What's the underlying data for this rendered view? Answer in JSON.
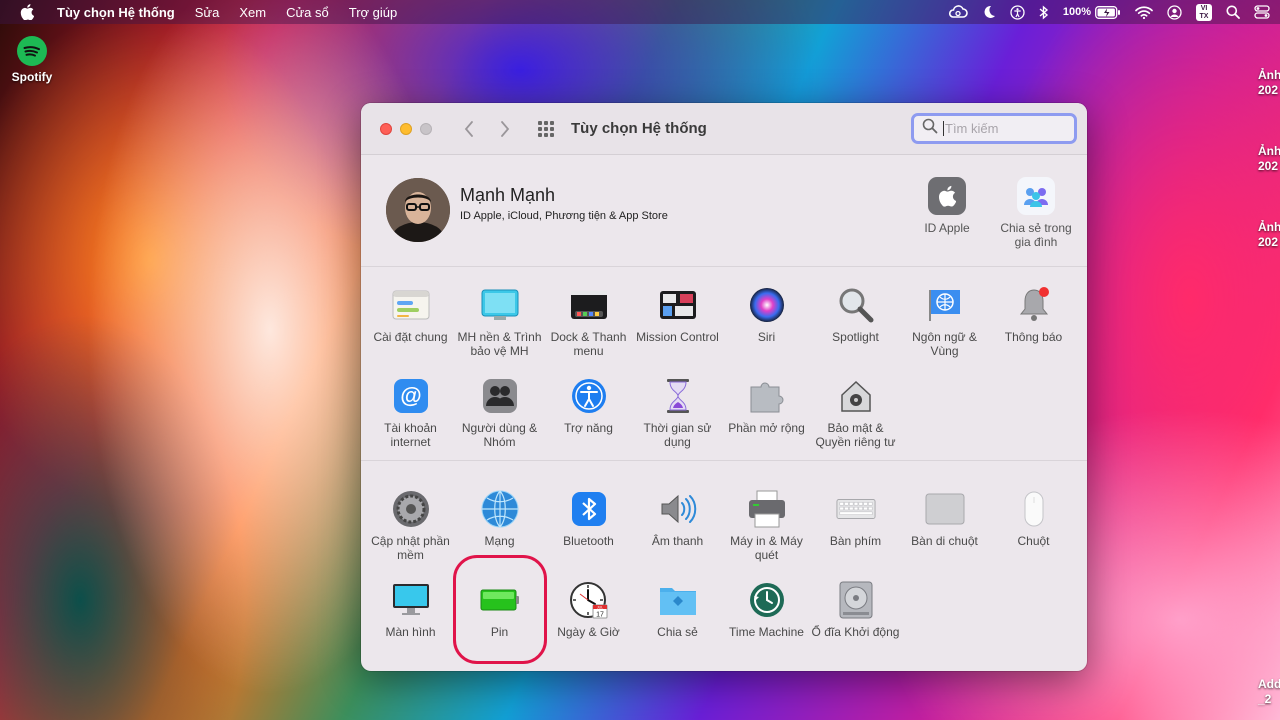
{
  "menubar": {
    "app_name": "Tùy chọn Hệ thống",
    "items": [
      "Sửa",
      "Xem",
      "Cửa sổ",
      "Trợ giúp"
    ],
    "battery_pct": "100%",
    "input_method": "VI TX"
  },
  "desktop": {
    "spotify_label": "Spotify",
    "files": [
      "Ảnh 202",
      "Ảnh 202",
      "Ảnh 202",
      "Add _2"
    ]
  },
  "window": {
    "title": "Tùy chọn Hệ thống",
    "search_placeholder": "Tìm kiếm",
    "user": {
      "name": "Mạnh Mạnh",
      "subtitle": "ID Apple, iCloud, Phương tiện & App Store"
    },
    "top_prefs": [
      {
        "id": "apple-id",
        "label": "ID Apple"
      },
      {
        "id": "family-sharing",
        "label": "Chia sẻ trong gia đình"
      }
    ],
    "row1": [
      {
        "id": "general",
        "label": "Cài đặt chung"
      },
      {
        "id": "desktop-screensaver",
        "label": "MH nền & Trình bảo vệ MH"
      },
      {
        "id": "dock",
        "label": "Dock & Thanh menu"
      },
      {
        "id": "mission-control",
        "label": "Mission Control"
      },
      {
        "id": "siri",
        "label": "Siri"
      },
      {
        "id": "spotlight",
        "label": "Spotlight"
      },
      {
        "id": "language-region",
        "label": "Ngôn ngữ & Vùng"
      },
      {
        "id": "notifications",
        "label": "Thông báo"
      }
    ],
    "row2": [
      {
        "id": "internet-accounts",
        "label": "Tài khoản internet"
      },
      {
        "id": "users-groups",
        "label": "Người dùng & Nhóm"
      },
      {
        "id": "accessibility",
        "label": "Trợ năng"
      },
      {
        "id": "screen-time",
        "label": "Thời gian sử dụng"
      },
      {
        "id": "extensions",
        "label": "Phần mở rộng"
      },
      {
        "id": "security-privacy",
        "label": "Bảo mật & Quyền riêng tư"
      }
    ],
    "row3": [
      {
        "id": "software-update",
        "label": "Cập nhật phần mềm"
      },
      {
        "id": "network",
        "label": "Mạng"
      },
      {
        "id": "bluetooth",
        "label": "Bluetooth"
      },
      {
        "id": "sound",
        "label": "Âm thanh"
      },
      {
        "id": "printers",
        "label": "Máy in & Máy quét"
      },
      {
        "id": "keyboard",
        "label": "Bàn phím"
      },
      {
        "id": "trackpad",
        "label": "Bàn di chuột"
      },
      {
        "id": "mouse",
        "label": "Chuột"
      }
    ],
    "row4": [
      {
        "id": "displays",
        "label": "Màn hình"
      },
      {
        "id": "battery",
        "label": "Pin"
      },
      {
        "id": "date-time",
        "label": "Ngày & Giờ"
      },
      {
        "id": "sharing",
        "label": "Chia sẻ"
      },
      {
        "id": "time-machine",
        "label": "Time Machine"
      },
      {
        "id": "startup-disk",
        "label": "Ổ đĩa Khởi động"
      }
    ],
    "calendar_day": "17",
    "calendar_month": "JUL"
  },
  "colors": {
    "highlight_ring": "#e0144a",
    "search_focus": "#8e9bf0",
    "window_bg": "#ece7ec"
  }
}
